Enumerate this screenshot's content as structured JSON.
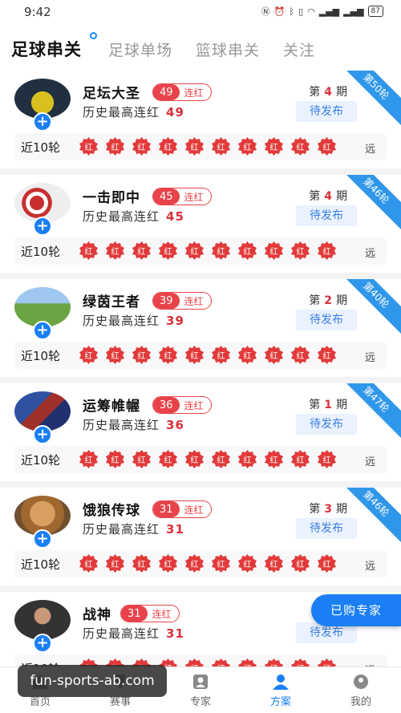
{
  "status": {
    "time": "9:42",
    "battery": "87"
  },
  "tabs": [
    {
      "label": "足球串关",
      "active": true
    },
    {
      "label": "足球单场",
      "active": false
    },
    {
      "label": "篮球串关",
      "active": false
    },
    {
      "label": "关注",
      "active": false
    }
  ],
  "labels": {
    "streak": "连红",
    "history": "历史最高连红",
    "period_prefix": "第",
    "period_suffix": "期",
    "pending": "待发布",
    "recent": "近10轮",
    "more": "远",
    "mark": "红"
  },
  "experts": [
    {
      "name": "足坛大圣",
      "streak": "49",
      "history": "49",
      "period": "4",
      "round": "第50轮",
      "avatar": "car-icon"
    },
    {
      "name": "一击即中",
      "streak": "45",
      "history": "45",
      "period": "4",
      "round": "第46轮",
      "avatar": "dart-icon"
    },
    {
      "name": "绿茵王者",
      "streak": "39",
      "history": "39",
      "period": "2",
      "round": "第40轮",
      "avatar": "grassland-icon"
    },
    {
      "name": "运筹帷幄",
      "streak": "36",
      "history": "36",
      "period": "1",
      "round": "第47轮",
      "avatar": "player-icon"
    },
    {
      "name": "饿狼传球",
      "streak": "31",
      "history": "31",
      "period": "3",
      "round": "第46轮",
      "avatar": "warrior-icon"
    },
    {
      "name": "战神",
      "streak": "31",
      "history": "31",
      "period": "",
      "round": "",
      "avatar": "man-icon"
    }
  ],
  "floating": {
    "purchased": "已购专家"
  },
  "nav": [
    {
      "label": "首页",
      "icon": "home-icon"
    },
    {
      "label": "赛事",
      "icon": "trophy-icon"
    },
    {
      "label": "专家",
      "icon": "expert-icon"
    },
    {
      "label": "方案",
      "icon": "plan-icon",
      "active": true
    },
    {
      "label": "我的",
      "icon": "profile-icon"
    }
  ],
  "watermark": "fun-sports-ab.com",
  "colors": {
    "accent": "#1a7ff5",
    "red": "#e8434a",
    "ribbon": "#2f97ea"
  }
}
